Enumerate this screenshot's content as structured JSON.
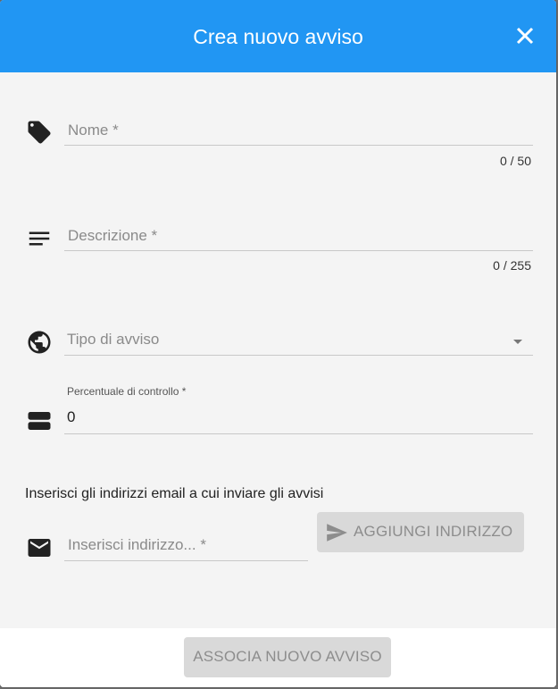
{
  "dialog": {
    "title": "Crea nuovo avviso",
    "close_icon": "close-icon"
  },
  "form": {
    "name": {
      "placeholder": "Nome *",
      "counter": "0 / 50",
      "icon": "tag-icon"
    },
    "description": {
      "placeholder": "Descrizione *",
      "counter": "0 / 255",
      "icon": "notes-icon"
    },
    "alert_type": {
      "placeholder": "Tipo di avviso",
      "icon": "globe-icon"
    },
    "control_percentage": {
      "label": "Percentuale di controllo *",
      "value": "0",
      "icon": "storage-icon"
    },
    "email_section": {
      "text": "Inserisci gli indirizzi email a cui inviare gli avvisi",
      "placeholder": "Inserisci indirizzo... *",
      "icon": "email-icon",
      "add_button": "AGGIUNGI INDIRIZZO",
      "add_icon": "send-icon"
    }
  },
  "footer": {
    "submit_button": "ASSOCIA NUOVO AVVISO"
  },
  "colors": {
    "header": "#2196f3",
    "background": "#f4f4f4",
    "disabled_button": "#d9d9d9"
  }
}
